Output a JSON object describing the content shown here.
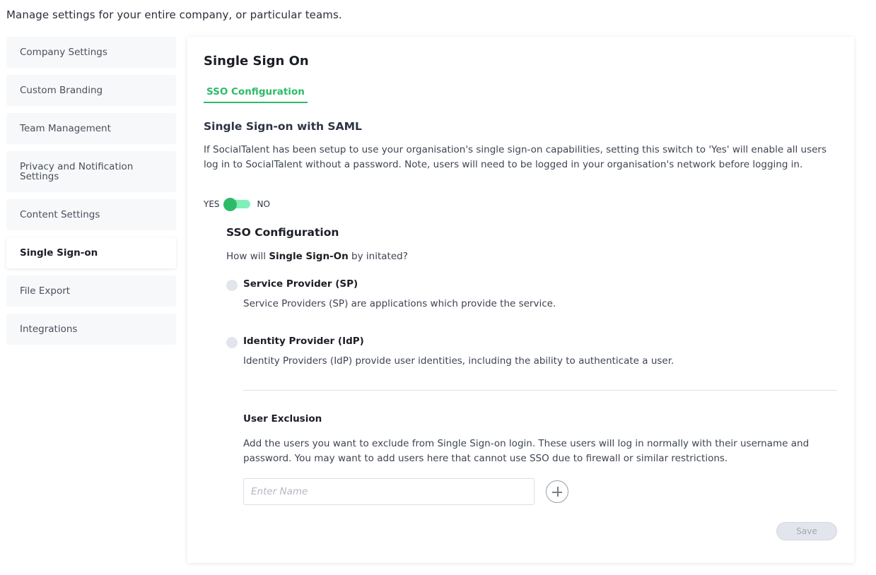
{
  "page": {
    "intro": "Manage settings for your entire company, or particular teams."
  },
  "sidebar": {
    "items": [
      {
        "label": "Company Settings",
        "active": false
      },
      {
        "label": "Custom Branding",
        "active": false
      },
      {
        "label": "Team Management",
        "active": false
      },
      {
        "label": "Privacy and Notification Settings",
        "active": false
      },
      {
        "label": "Content Settings",
        "active": false
      },
      {
        "label": "Single Sign-on",
        "active": true
      },
      {
        "label": "File Export",
        "active": false
      },
      {
        "label": "Integrations",
        "active": false
      }
    ]
  },
  "card": {
    "title": "Single Sign On",
    "tabs": [
      {
        "label": "SSO Configuration",
        "active": true
      }
    ],
    "saml": {
      "title": "Single Sign-on with SAML",
      "description": "If SocialTalent has been setup to use your organisation's single sign-on capabilities, setting this switch to 'Yes' will enable all users log in to SocialTalent without a password. Note, users will need to be logged in your organisation's network before logging in.",
      "toggle": {
        "yes_label": "YES",
        "no_label": "NO",
        "value": "YES"
      }
    },
    "sso_config": {
      "title": "SSO Configuration",
      "question_prefix": "How will ",
      "question_bold": "Single Sign-On",
      "question_suffix": " by initated?",
      "options": [
        {
          "label": "Service Provider (SP)",
          "description": "Service Providers (SP) are applications which provide the service.",
          "selected": false
        },
        {
          "label": "Identity Provider (IdP)",
          "description": "Identity Providers (IdP) provide user identities, including the ability to authenticate a user.",
          "selected": false
        }
      ]
    },
    "user_exclusion": {
      "title": "User Exclusion",
      "description": "Add the users you want to exclude from Single Sign-on login. These users will log in normally with their username and password. You may want to add users here that cannot use SSO due to firewall or similar restrictions.",
      "input_placeholder": "Enter Name",
      "input_value": ""
    },
    "save_label": "Save"
  },
  "colors": {
    "accent": "#2dbb6a",
    "toggle_track": "#7ef0b8",
    "sidebar_bg": "#f7f8fa",
    "radio_bg": "#e3e5ec"
  }
}
